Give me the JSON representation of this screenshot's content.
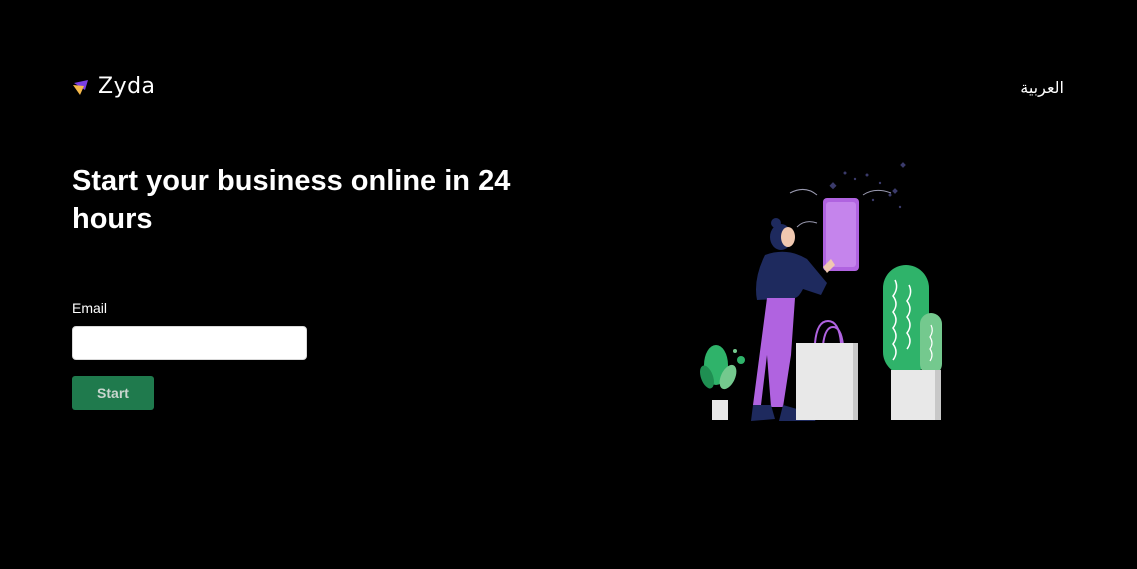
{
  "header": {
    "brand_name": "Zyda",
    "language_switch": "العربية"
  },
  "hero": {
    "headline": "Start your business online in 24 hours"
  },
  "signup_form": {
    "email_label": "Email",
    "email_value": "",
    "email_placeholder": "",
    "submit_label": "Start"
  },
  "colors": {
    "background": "#000000",
    "button": "#1f7a4d",
    "illustration_purple": "#b063e0",
    "illustration_green": "#2fb36a"
  },
  "icons": [
    "zyda-logo-icon"
  ]
}
